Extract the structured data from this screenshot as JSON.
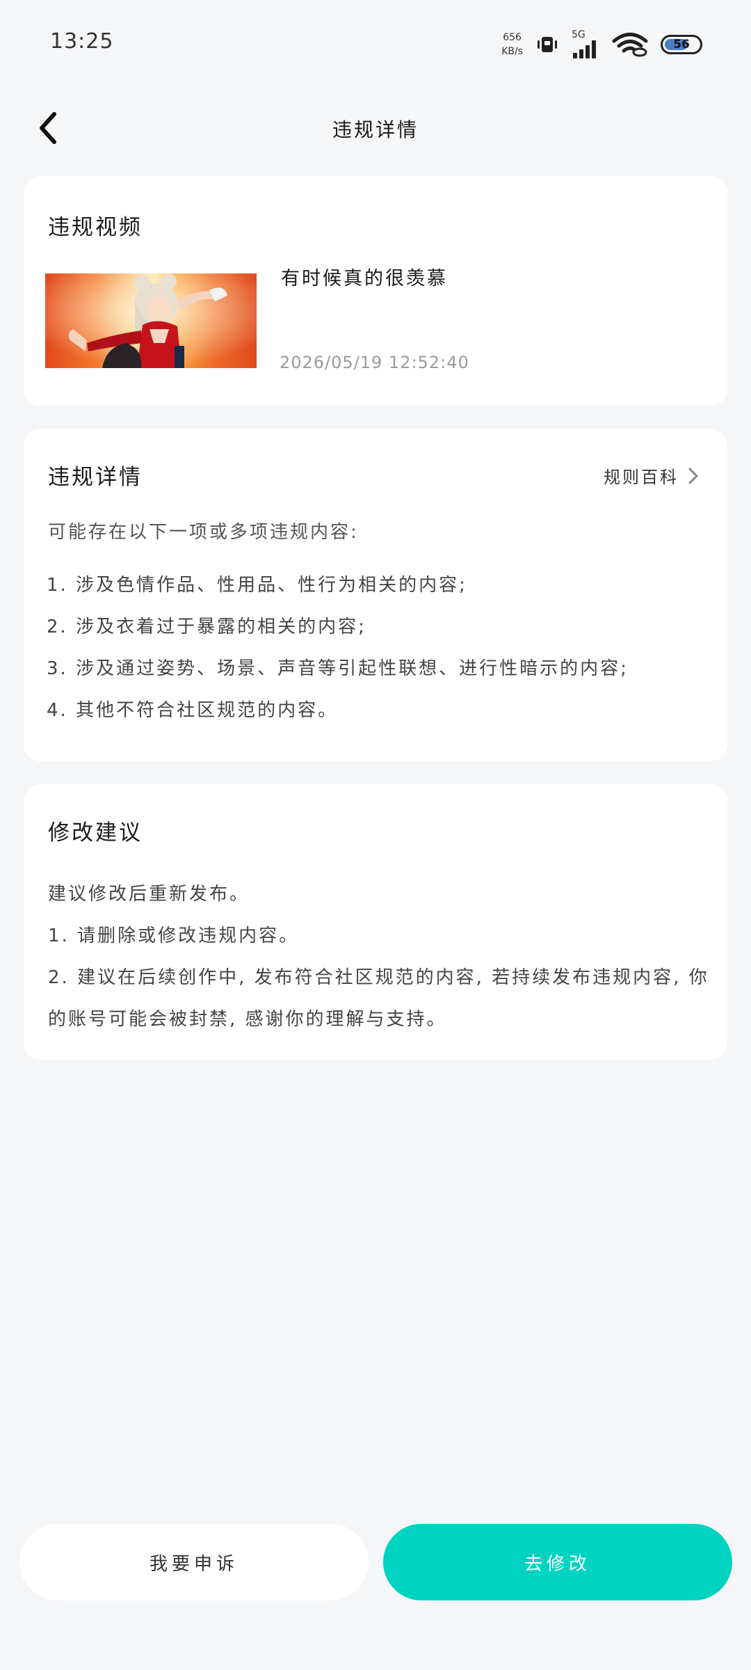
{
  "status_bar": {
    "time": "13:25",
    "net_speed_value": "656",
    "net_speed_unit": "KB/s",
    "network": "5G",
    "battery": "56"
  },
  "nav": {
    "title": "违规详情"
  },
  "video_card": {
    "title": "违规视频",
    "video_title": "有时候真的很羡慕",
    "timestamp": "2026/05/19 12:52:40"
  },
  "detail_card": {
    "title": "违规详情",
    "rules_link": "规则百科",
    "intro": "可能存在以下一项或多项违规内容:",
    "items": [
      "1. 涉及色情作品、性用品、性行为相关的内容;",
      "2. 涉及衣着过于暴露的相关的内容;",
      "3. 涉及通过姿势、场景、声音等引起性联想、进行性暗示的内容;",
      "4. 其他不符合社区规范的内容。"
    ]
  },
  "advice_card": {
    "title": "修改建议",
    "lines": [
      "建议修改后重新发布。",
      "1. 请删除或修改违规内容。",
      "2. 建议在后续创作中, 发布符合社区规范的内容, 若持续发布违规内容, 你的账号可能会被封禁, 感谢你的理解与支持。"
    ]
  },
  "buttons": {
    "appeal": "我要申诉",
    "modify": "去修改"
  },
  "colors": {
    "accent": "#00d4c1",
    "background": "#f5f6f8",
    "card": "#ffffff"
  }
}
